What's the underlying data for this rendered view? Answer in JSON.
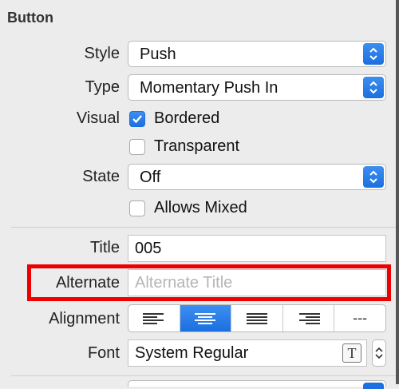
{
  "section": {
    "title": "Button"
  },
  "style": {
    "label": "Style",
    "value": "Push"
  },
  "type": {
    "label": "Type",
    "value": "Momentary Push In"
  },
  "visual": {
    "label": "Visual",
    "bordered": {
      "label": "Bordered",
      "checked": true
    },
    "transparent": {
      "label": "Transparent",
      "checked": false
    }
  },
  "state": {
    "label": "State",
    "value": "Off",
    "allows_mixed": {
      "label": "Allows Mixed",
      "checked": false
    }
  },
  "title_field": {
    "label": "Title",
    "value": "005"
  },
  "alternate_field": {
    "label": "Alternate",
    "placeholder": "Alternate Title",
    "value": ""
  },
  "alignment": {
    "label": "Alignment",
    "options": [
      "left",
      "center",
      "justified",
      "right",
      "natural"
    ],
    "selected": "center",
    "natural_text": "---"
  },
  "font": {
    "label": "Font",
    "value": "System Regular",
    "picker_glyph": "T"
  },
  "colors": {
    "accent": "#1b6fe0",
    "highlight": "#ee0000"
  }
}
